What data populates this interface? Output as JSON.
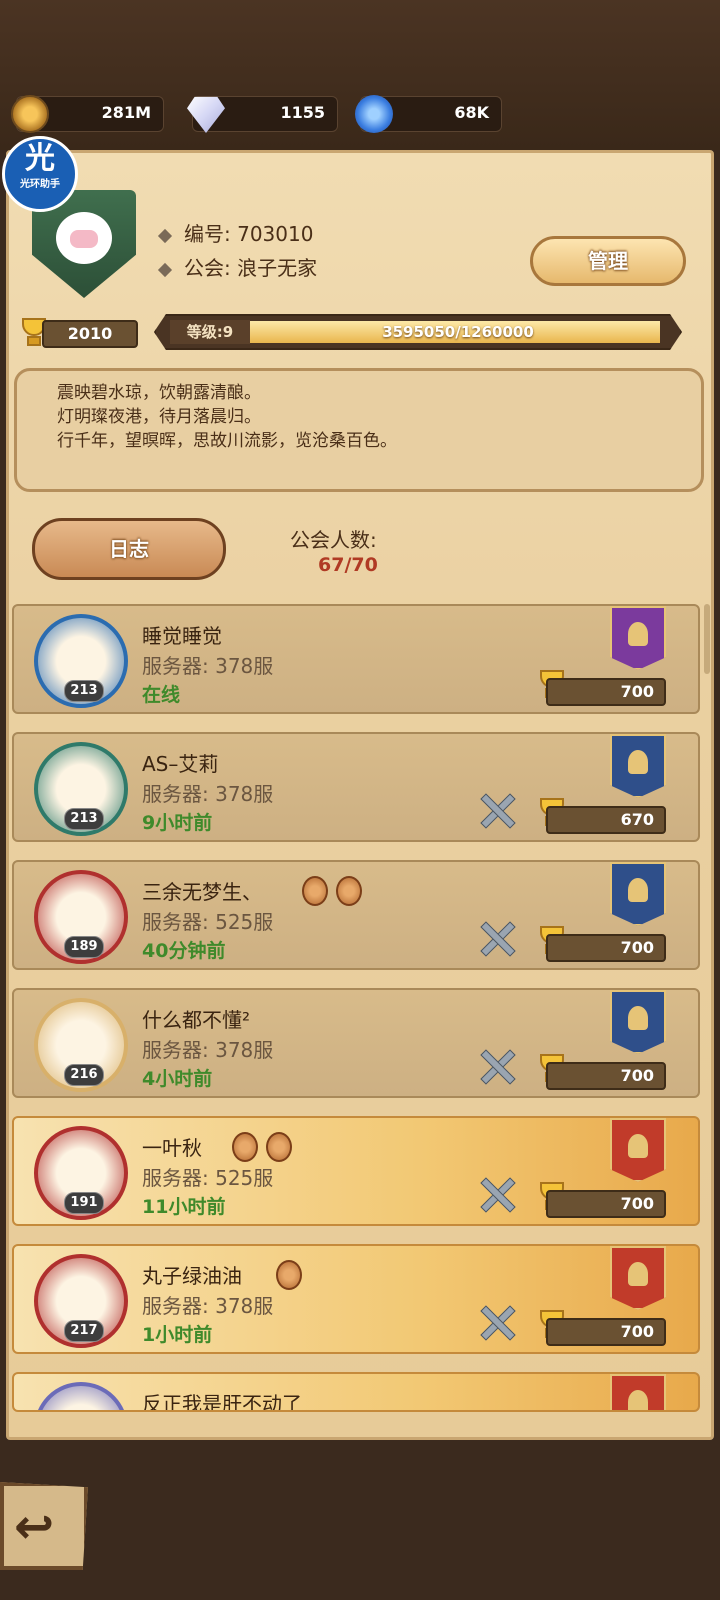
{
  "currencies": [
    {
      "icon": "gold-coin-icon",
      "value": "281M"
    },
    {
      "icon": "diamond-icon",
      "value": "1155"
    },
    {
      "icon": "blue-orb-icon",
      "value": "68K"
    }
  ],
  "watermark": {
    "big": "光",
    "small": "光环助手"
  },
  "guild": {
    "id_label": "编号: 703010",
    "name_label": "公会: 浪子无家",
    "manage_label": "管理",
    "trophies": "2010",
    "level_label": "等级:9",
    "exp_text": "3595050/1260000",
    "exp_fraction": 1.0,
    "motto_lines": [
      "震映碧水琼，饮朝露清酿。",
      "灯明璨夜港，待月落晨归。",
      "行千年，望暝晖，思故川流影，览沧桑百色。"
    ],
    "log_label": "日志",
    "members_label": "公会人数:",
    "members_count": "67/70"
  },
  "members": [
    {
      "name": "睡觉睡觉",
      "server": "服务器: 378服",
      "status": "在线",
      "level": "213",
      "trophies": "700",
      "rank": "purple",
      "crossed_swords": false,
      "gold": false,
      "badges": 0
    },
    {
      "name": "AS–艾莉",
      "server": "服务器: 378服",
      "status": "9小时前",
      "level": "213",
      "trophies": "670",
      "rank": "blue",
      "crossed_swords": true,
      "gold": false,
      "badges": 0
    },
    {
      "name": "三余无梦生、",
      "server": "服务器: 525服",
      "status": "40分钟前",
      "level": "189",
      "trophies": "700",
      "rank": "blue",
      "crossed_swords": true,
      "gold": false,
      "badges": 2
    },
    {
      "name": "什么都不懂²",
      "server": "服务器: 378服",
      "status": "4小时前",
      "level": "216",
      "trophies": "700",
      "rank": "blue",
      "crossed_swords": true,
      "gold": false,
      "badges": 0
    },
    {
      "name": "一叶秋",
      "server": "服务器: 525服",
      "status": "11小时前",
      "level": "191",
      "trophies": "700",
      "rank": "red",
      "crossed_swords": true,
      "gold": true,
      "badges": 2
    },
    {
      "name": "丸子绿油油",
      "server": "服务器: 378服",
      "status": "1小时前",
      "level": "217",
      "trophies": "700",
      "rank": "red",
      "crossed_swords": true,
      "gold": true,
      "badges": 1
    },
    {
      "name": "反正我是肝不动了",
      "server": "",
      "status": "",
      "level": "",
      "trophies": "",
      "rank": "red",
      "crossed_swords": false,
      "gold": true,
      "badges": 0
    }
  ]
}
